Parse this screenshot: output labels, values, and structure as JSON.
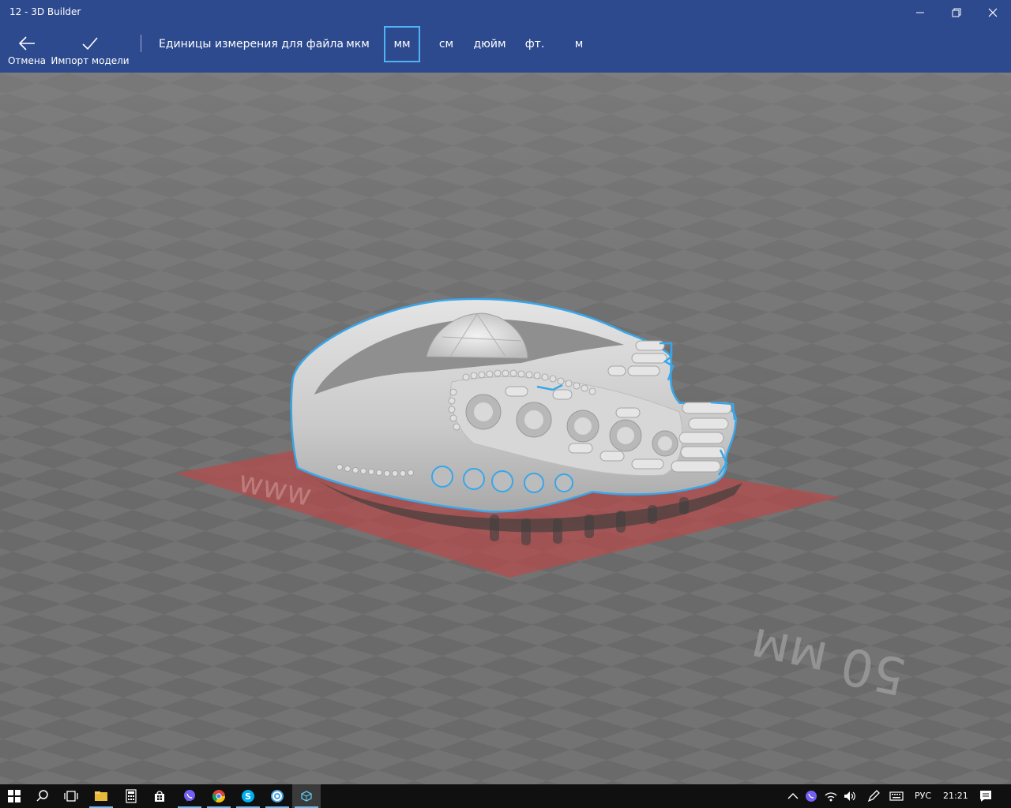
{
  "window": {
    "title": "12 - 3D Builder"
  },
  "toolbar": {
    "cancel_label": "Отмена",
    "cancel_icon": "arrow-left-icon",
    "import_label": "Импорт модели",
    "import_icon": "checkmark-icon",
    "units_label": "Единицы измерения для файла",
    "units": [
      "мкм",
      "мм",
      "см",
      "дюйм",
      "фт.",
      "м"
    ],
    "selected_unit": "мм"
  },
  "viewport": {
    "scale_label_left": "www",
    "scale_label_right": "50 мм",
    "model": "ring-model",
    "colors": {
      "grid_light": "#7a7a7a",
      "grid_dark": "#6a6a6a",
      "footprint": "#b44c4c",
      "selection_outline": "#3aa6e8",
      "model": "#cfcfcf"
    }
  },
  "taskbar": {
    "language": "РУС",
    "time": "21:21",
    "apps": [
      "start-icon",
      "search-icon",
      "task-view-icon",
      "file-explorer-icon",
      "calculator-icon",
      "store-icon",
      "viber-icon",
      "chrome-icon",
      "skype-icon",
      "settings-app-icon",
      "3d-builder-icon"
    ]
  },
  "colors": {
    "header": "#2d4a8e",
    "accent": "#4fb3f6",
    "taskbar": "#101010"
  }
}
